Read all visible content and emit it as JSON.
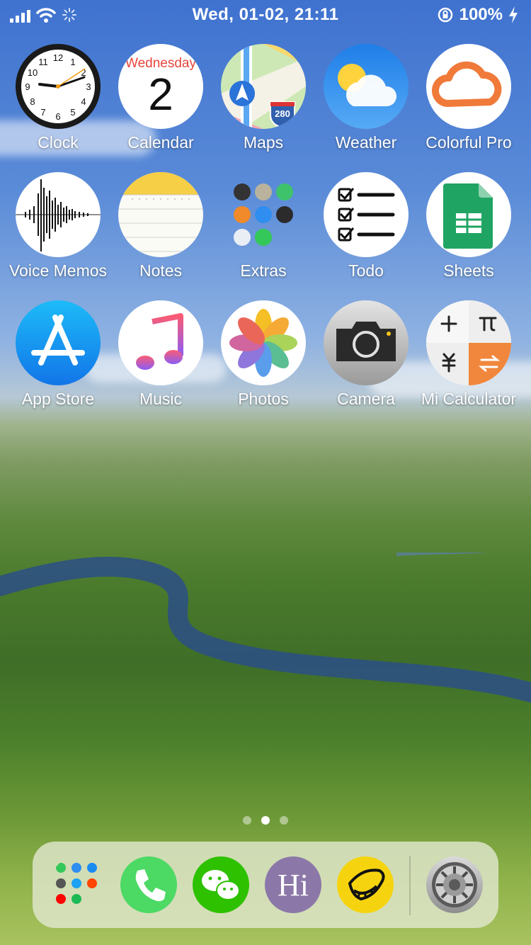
{
  "status_bar": {
    "datetime": "Wed, 01-02, 21:11",
    "battery": "100%"
  },
  "apps": [
    {
      "id": "clock",
      "label": "Clock",
      "icon": "clock-icon"
    },
    {
      "id": "calendar",
      "label": "Calendar",
      "icon": "calendar-icon",
      "weekday": "Wednesday",
      "day": "2"
    },
    {
      "id": "maps",
      "label": "Maps",
      "icon": "maps-icon",
      "shield": "280"
    },
    {
      "id": "weather",
      "label": "Weather",
      "icon": "weather-icon"
    },
    {
      "id": "colorful-pro",
      "label": "Colorful Pro",
      "icon": "cloud-outline-icon"
    },
    {
      "id": "voice-memos",
      "label": "Voice Memos",
      "icon": "waveform-icon"
    },
    {
      "id": "notes",
      "label": "Notes",
      "icon": "notes-icon"
    },
    {
      "id": "extras",
      "label": "Extras",
      "icon": "folder-icon"
    },
    {
      "id": "todo",
      "label": "Todo",
      "icon": "checklist-icon"
    },
    {
      "id": "sheets",
      "label": "Sheets",
      "icon": "sheets-icon"
    },
    {
      "id": "app-store",
      "label": "App Store",
      "icon": "app-store-icon"
    },
    {
      "id": "music",
      "label": "Music",
      "icon": "music-note-icon"
    },
    {
      "id": "photos",
      "label": "Photos",
      "icon": "photos-flower-icon"
    },
    {
      "id": "camera",
      "label": "Camera",
      "icon": "camera-icon"
    },
    {
      "id": "mi-calculator",
      "label": "Mi Calculator",
      "icon": "calculator-icon"
    }
  ],
  "page_indicator": {
    "pages": 3,
    "current": 2
  },
  "dock": [
    {
      "id": "social-folder",
      "icon": "folder-icon"
    },
    {
      "id": "phone",
      "icon": "phone-icon"
    },
    {
      "id": "wechat",
      "icon": "wechat-icon"
    },
    {
      "id": "hi",
      "icon": "hi-icon",
      "text": "Hi"
    },
    {
      "id": "yellow-app",
      "icon": "smile-icon"
    },
    {
      "id": "settings",
      "icon": "settings-gear-icon"
    }
  ],
  "colors": {
    "calendar_red": "#e8453c",
    "weather_blue": "#2f8ef0",
    "phone_green": "#4cd964",
    "wechat_green": "#2dc100",
    "hi_purple": "#8c78a8",
    "sheets_green": "#1fa463",
    "calc_orange": "#f0873c"
  }
}
